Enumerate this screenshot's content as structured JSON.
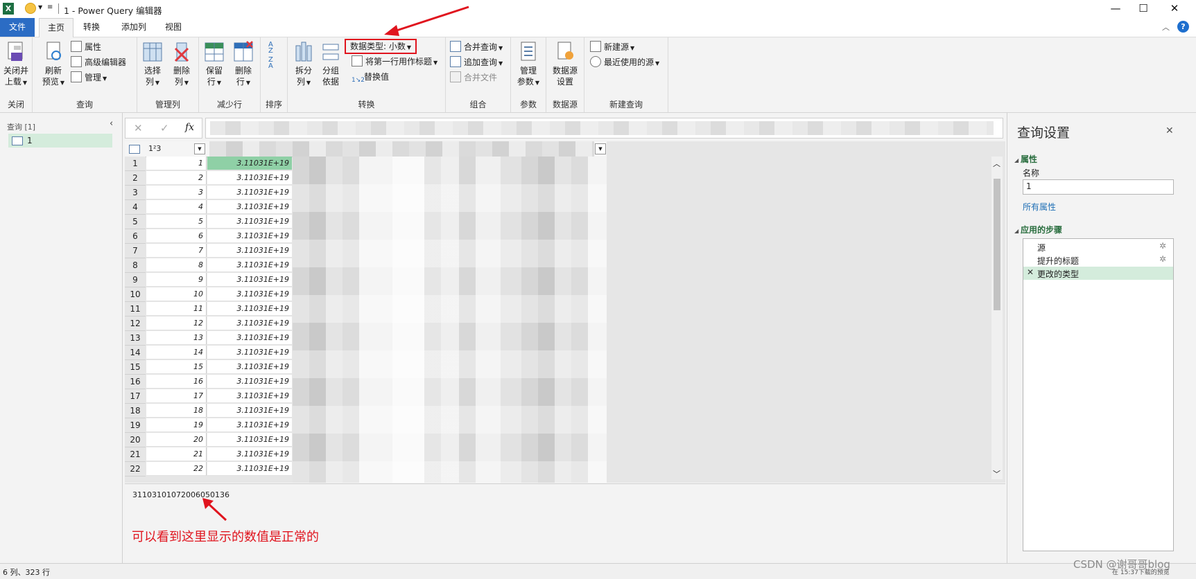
{
  "title": {
    "app_icon": "X",
    "text": "1 - Power Query 编辑器",
    "minimize": "—",
    "maximize": "☐",
    "close": "✕"
  },
  "tabs": [
    {
      "label": "文件"
    },
    {
      "label": "主页"
    },
    {
      "label": "转换"
    },
    {
      "label": "添加列"
    },
    {
      "label": "视图"
    }
  ],
  "ribbon": {
    "close": {
      "label1": "关闭并",
      "label2": "上载",
      "group": "关闭"
    },
    "query": {
      "refresh1": "刷新",
      "refresh2": "预览",
      "properties": "属性",
      "advanced_editor": "高级编辑器",
      "manage": "管理",
      "group": "查询"
    },
    "manage_cols": {
      "choose1": "选择",
      "choose2": "列",
      "remove1": "删除",
      "remove2": "列",
      "group": "管理列"
    },
    "reduce_rows": {
      "keep1": "保留",
      "keep2": "行",
      "remove1": "删除",
      "remove2": "行",
      "group": "减少行"
    },
    "sort": {
      "group": "排序"
    },
    "transform": {
      "split1": "拆分",
      "split2": "列",
      "groupby1": "分组",
      "groupby2": "依据",
      "data_type": "数据类型: 小数",
      "first_row_header": "将第一行用作标题",
      "replace_values": "替换值",
      "group": "转换"
    },
    "combine": {
      "merge": "合并查询",
      "append": "追加查询",
      "combine_files": "合并文件",
      "group": "组合"
    },
    "params": {
      "label1": "管理",
      "label2": "参数",
      "group": "参数"
    },
    "datasource": {
      "label1": "数据源",
      "label2": "设置",
      "group": "数据源"
    },
    "new_query": {
      "new_source": "新建源",
      "recent_sources": "最近使用的源",
      "group": "新建查询"
    }
  },
  "left_pane": {
    "header": "查询 [1]",
    "item": "1"
  },
  "formula_bar": {
    "cancel": "✕",
    "confirm": "✓",
    "fx": "fx"
  },
  "grid": {
    "col1_type": "1²3",
    "rows": [
      {
        "n": "1",
        "idx": "1",
        "val": "3.11031E+19"
      },
      {
        "n": "2",
        "idx": "2",
        "val": "3.11031E+19"
      },
      {
        "n": "3",
        "idx": "3",
        "val": "3.11031E+19"
      },
      {
        "n": "4",
        "idx": "4",
        "val": "3.11031E+19"
      },
      {
        "n": "5",
        "idx": "5",
        "val": "3.11031E+19"
      },
      {
        "n": "6",
        "idx": "6",
        "val": "3.11031E+19"
      },
      {
        "n": "7",
        "idx": "7",
        "val": "3.11031E+19"
      },
      {
        "n": "8",
        "idx": "8",
        "val": "3.11031E+19"
      },
      {
        "n": "9",
        "idx": "9",
        "val": "3.11031E+19"
      },
      {
        "n": "10",
        "idx": "10",
        "val": "3.11031E+19"
      },
      {
        "n": "11",
        "idx": "11",
        "val": "3.11031E+19"
      },
      {
        "n": "12",
        "idx": "12",
        "val": "3.11031E+19"
      },
      {
        "n": "13",
        "idx": "13",
        "val": "3.11031E+19"
      },
      {
        "n": "14",
        "idx": "14",
        "val": "3.11031E+19"
      },
      {
        "n": "15",
        "idx": "15",
        "val": "3.11031E+19"
      },
      {
        "n": "16",
        "idx": "16",
        "val": "3.11031E+19"
      },
      {
        "n": "17",
        "idx": "17",
        "val": "3.11031E+19"
      },
      {
        "n": "18",
        "idx": "18",
        "val": "3.11031E+19"
      },
      {
        "n": "19",
        "idx": "19",
        "val": "3.11031E+19"
      },
      {
        "n": "20",
        "idx": "20",
        "val": "3.11031E+19"
      },
      {
        "n": "21",
        "idx": "21",
        "val": "3.11031E+19"
      },
      {
        "n": "22",
        "idx": "22",
        "val": "3.11031E+19"
      }
    ]
  },
  "preview": {
    "value": "31103101072006050136",
    "annotation": "可以看到这里显示的数值是正常的"
  },
  "right_pane": {
    "title": "查询设置",
    "close": "✕",
    "properties_header": "属性",
    "name_label": "名称",
    "name_value": "1",
    "all_properties": "所有属性",
    "steps_header": "应用的步骤",
    "steps": [
      {
        "label": "源"
      },
      {
        "label": "提升的标题"
      },
      {
        "label": "更改的类型"
      }
    ]
  },
  "status": {
    "left": "6 列、323 行",
    "right": "在 15:37下载的预览",
    "watermark": "CSDN @谢哥哥blog"
  },
  "colors": {
    "file_tab": "#2b6cc4",
    "selected_cell": "#8fd0a6",
    "annotation_red": "#e0141e",
    "link": "#1f6fb5"
  }
}
